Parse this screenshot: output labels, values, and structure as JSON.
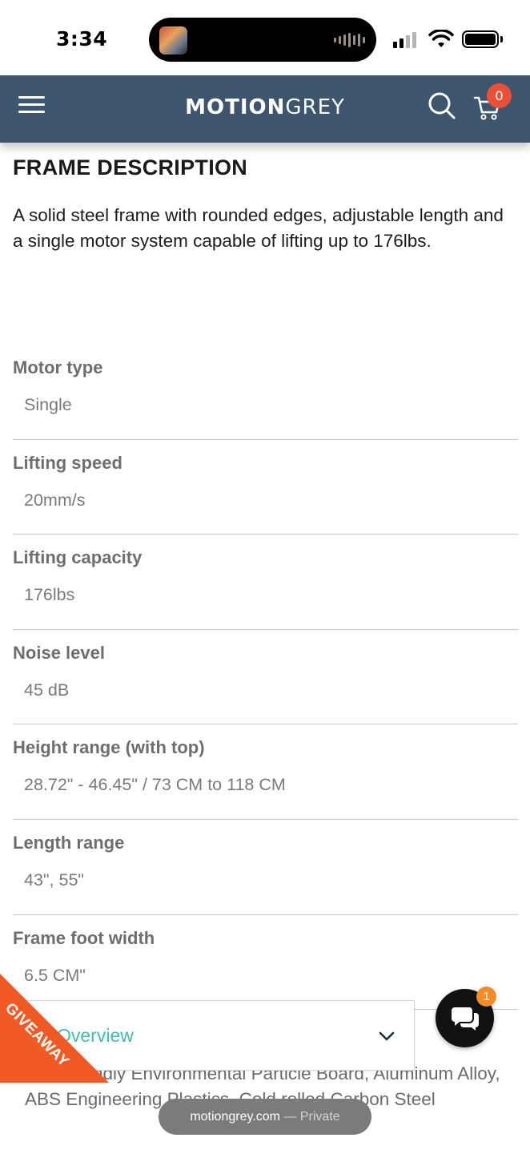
{
  "status_bar": {
    "time": "3:34"
  },
  "header": {
    "brand_bold": "MOTION",
    "brand_light": "GREY",
    "cart_count": "0",
    "icons": [
      "menu-icon",
      "search-icon",
      "cart-icon"
    ]
  },
  "frame_description": {
    "title": "FRAME DESCRIPTION",
    "text": "A solid steel frame with rounded edges, adjustable length and a single motor system capable of lifting up to 176lbs."
  },
  "specs": [
    {
      "label": "Motor type",
      "value": "Single"
    },
    {
      "label": "Lifting speed",
      "value": "20mm/s"
    },
    {
      "label": "Lifting capacity",
      "value": "176lbs"
    },
    {
      "label": "Noise level",
      "value": "45 dB"
    },
    {
      "label": "Height range (with top)",
      "value": "28.72\" - 46.45\" / 73 CM to 118 CM"
    },
    {
      "label": "Length range",
      "value": "43\", 55\""
    },
    {
      "label": "Frame foot width",
      "value": "6.5 CM\""
    }
  ],
  "material_text": "Eco-Friendly Environmental Particle Board, Aluminum Alloy, ABS Engineering Plastics, Cold rolled Carbon Steel",
  "overview": {
    "label": "Overview"
  },
  "giveaway": {
    "label": "GIVEAWAY",
    "color": "#f15a24"
  },
  "chat": {
    "badge_count": "1"
  },
  "browser": {
    "domain": "motiongrey.com",
    "private_label": " — Private"
  },
  "colors": {
    "header_bg": "#3d566e",
    "accent_teal": "#3fbfa7",
    "cart_badge": "#e8503a"
  }
}
